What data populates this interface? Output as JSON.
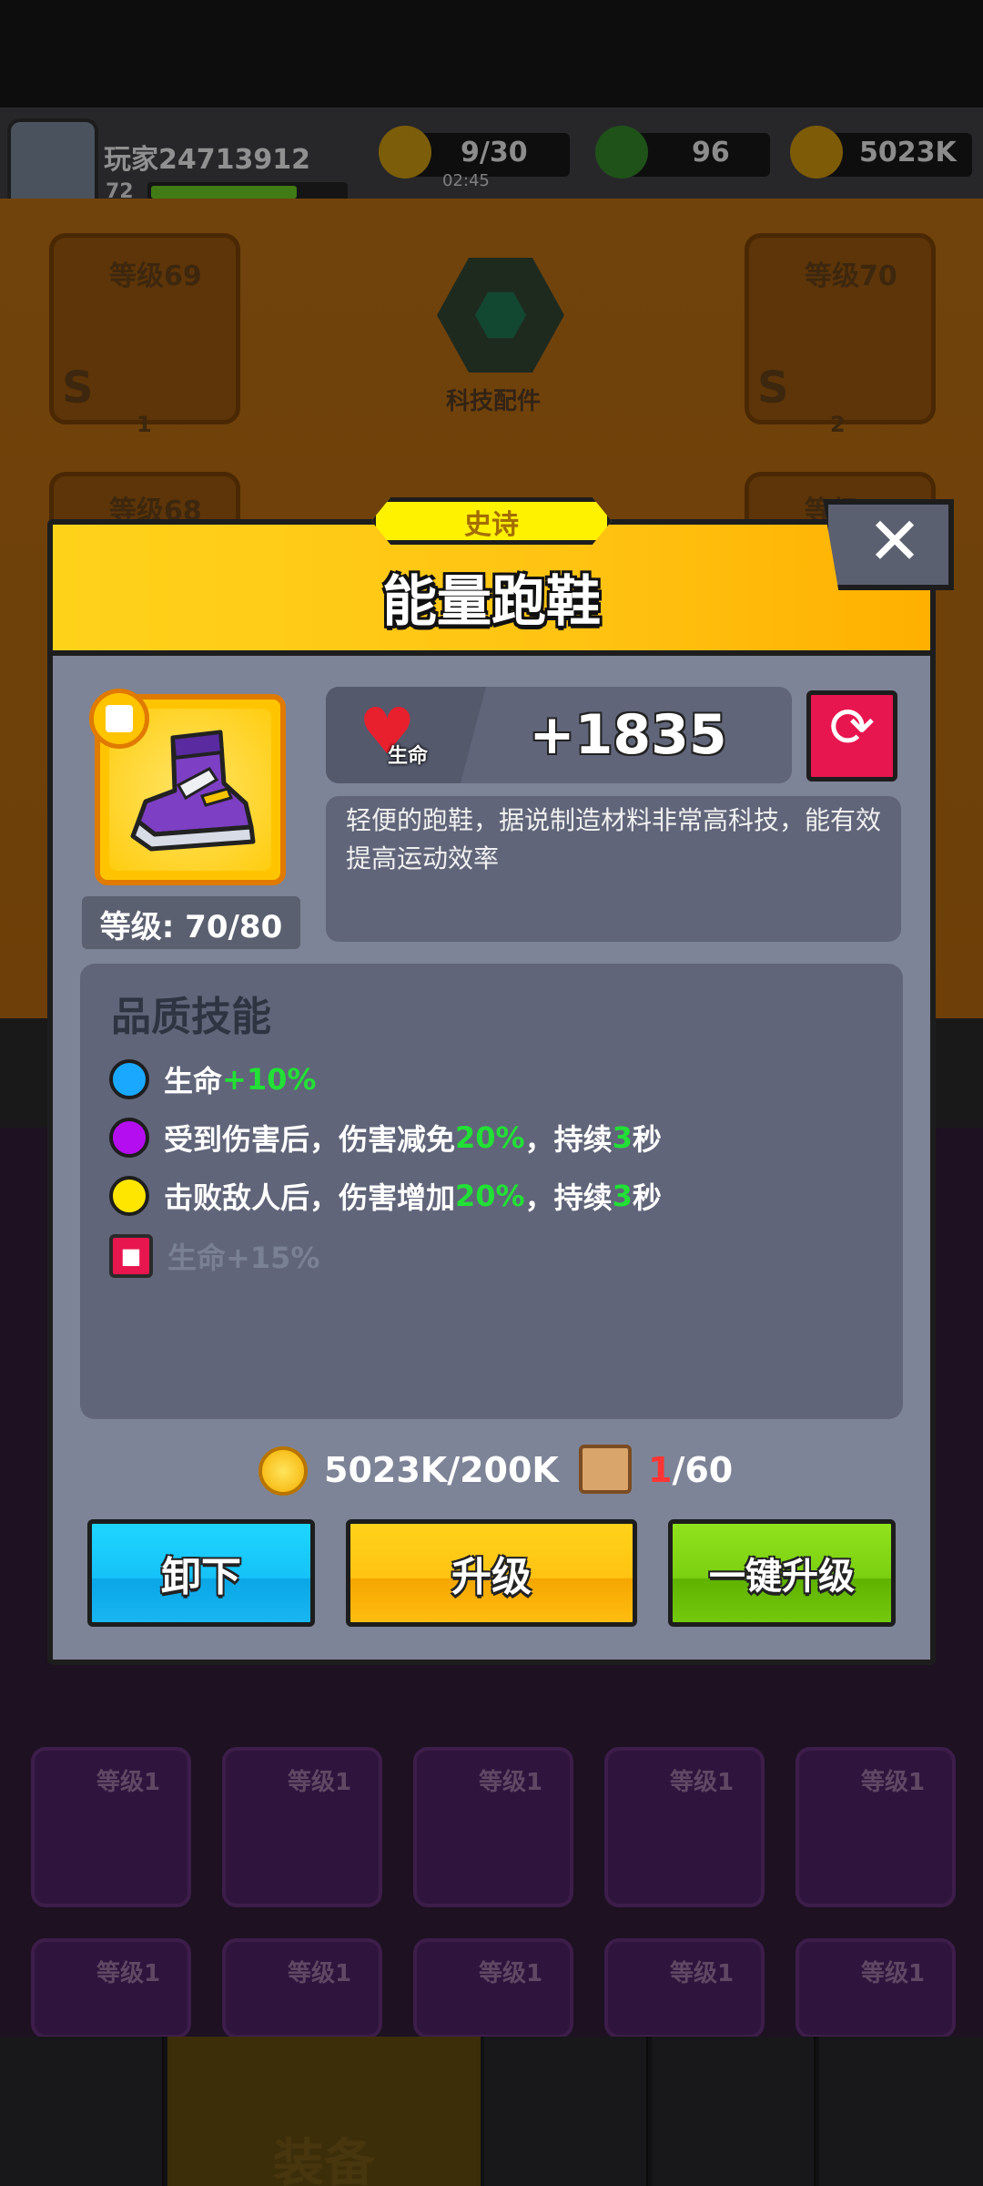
{
  "topbar": {
    "player_name": "玩家24713912",
    "player_level": "72",
    "energy": "9/30",
    "energy_timer": "02:45",
    "gems": "96",
    "gold": "5023K"
  },
  "background": {
    "slot_left_top_level": "等级69",
    "slot_left_top_grade": "S",
    "slot_left_top_count": "1",
    "slot_right_top_level": "等级70",
    "slot_right_top_grade": "S",
    "slot_right_top_count": "2",
    "slot_left_mid_level": "等级68",
    "slot_right_mid_level": "等级",
    "tech_label": "科技配件",
    "inventory_level_label": "等级1",
    "nav_active_label": "装备"
  },
  "dialog": {
    "rarity": "史诗",
    "title": "能量跑鞋",
    "level": "等级: 70/80",
    "stat_label": "生命",
    "stat_value": "+1835",
    "description": "轻便的跑鞋，据说制造材料非常高科技，能有效提高运动效率",
    "skills_title": "品质技能",
    "skills": [
      {
        "color": "#1aa8ff",
        "parts": [
          "生命",
          "+10%",
          "",
          "",
          ""
        ]
      },
      {
        "color": "#b40ef0",
        "parts": [
          "受到伤害后，伤害减免",
          "20%",
          "，持续",
          "3",
          "秒"
        ]
      },
      {
        "color": "#ffe600",
        "parts": [
          "击败敌人后，伤害增加",
          "20%",
          "，持续",
          "3",
          "秒"
        ]
      }
    ],
    "locked_skill": "生命+15%",
    "cost_gold": "5023K/200K",
    "cost_scroll_have": "1",
    "cost_scroll_need": "/60",
    "btn_unequip": "卸下",
    "btn_upgrade": "升级",
    "btn_upgrade_all": "一键升级",
    "close_symbol": "✕",
    "refresh_symbol": "⟳"
  }
}
